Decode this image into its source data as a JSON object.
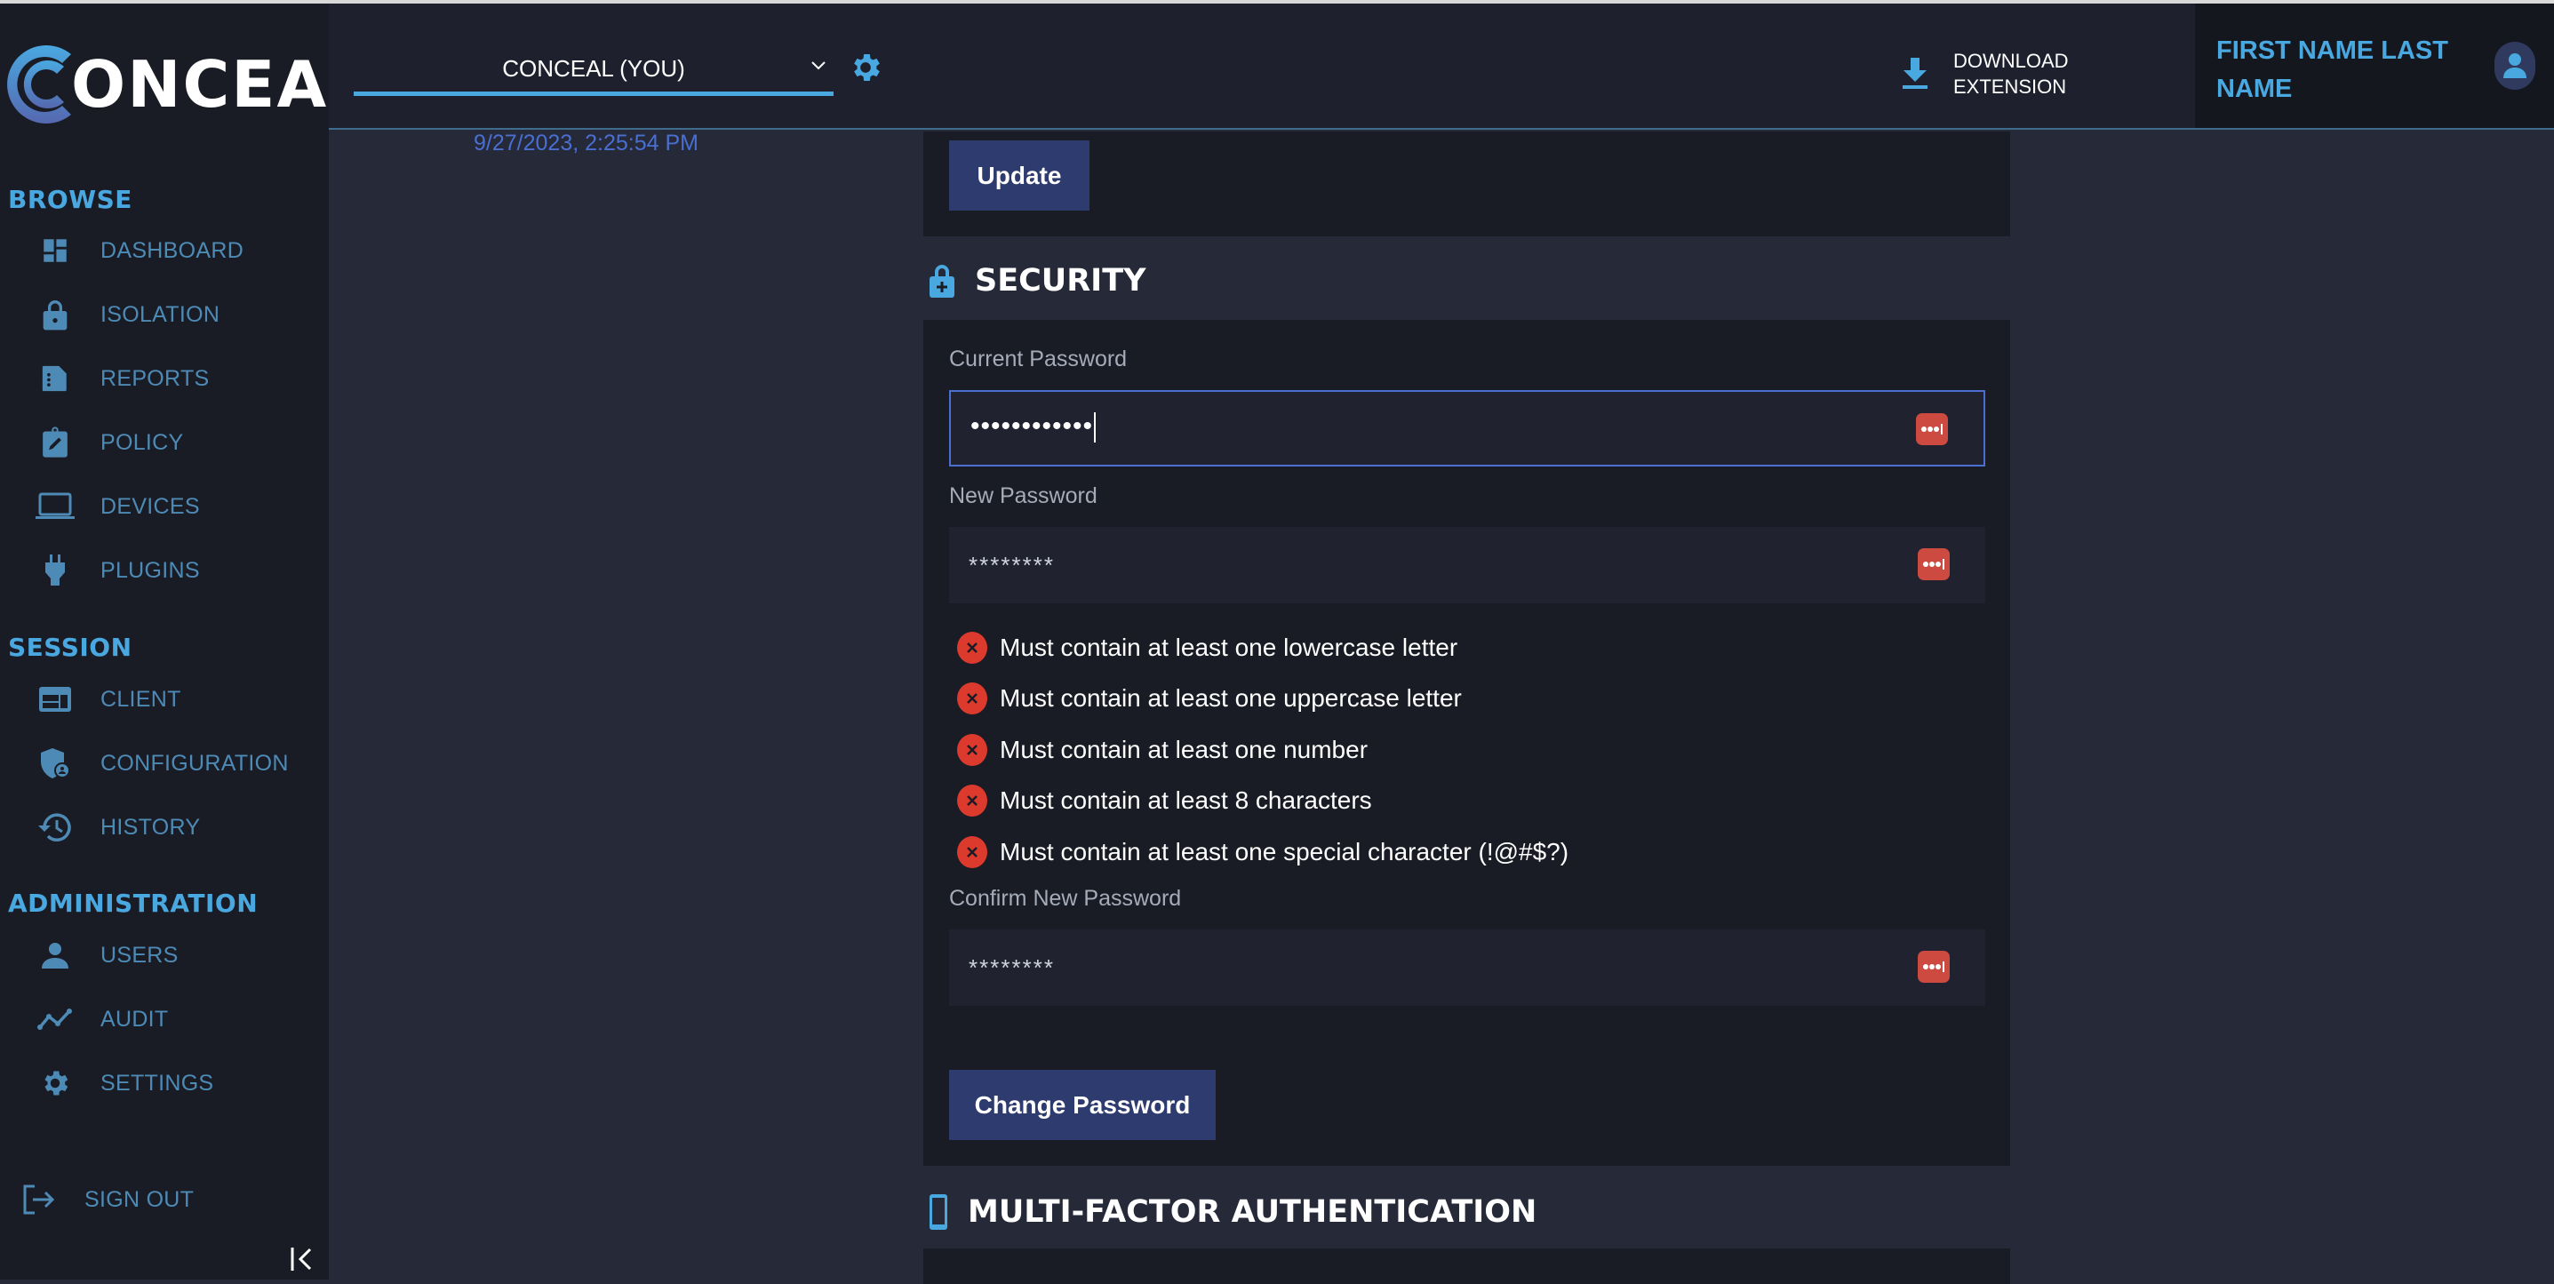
{
  "app": {
    "brand": "ONCEAL",
    "brand_full": "CONCEAL"
  },
  "sidebar": {
    "sections": [
      {
        "title": "BROWSE",
        "items": [
          {
            "label": "DASHBOARD",
            "icon": "dashboard-icon"
          },
          {
            "label": "ISOLATION",
            "icon": "lock-icon"
          },
          {
            "label": "REPORTS",
            "icon": "report-icon"
          },
          {
            "label": "POLICY",
            "icon": "clipboard-edit-icon"
          },
          {
            "label": "DEVICES",
            "icon": "laptop-icon"
          },
          {
            "label": "PLUGINS",
            "icon": "plug-icon"
          }
        ]
      },
      {
        "title": "SESSION",
        "items": [
          {
            "label": "CLIENT",
            "icon": "browser-window-icon"
          },
          {
            "label": "CONFIGURATION",
            "icon": "shield-user-icon"
          },
          {
            "label": "HISTORY",
            "icon": "history-icon"
          }
        ]
      },
      {
        "title": "ADMINISTRATION",
        "items": [
          {
            "label": "USERS",
            "icon": "user-icon"
          },
          {
            "label": "AUDIT",
            "icon": "trend-line-icon"
          },
          {
            "label": "SETTINGS",
            "icon": "gear-icon"
          }
        ]
      }
    ],
    "sign_out": "SIGN OUT"
  },
  "header": {
    "org_select": "CONCEAL (YOU)",
    "download_line1": "DOWNLOAD",
    "download_line2": "EXTENSION",
    "user_name": "FIRST NAME LAST NAME"
  },
  "main": {
    "timestamp": "9/27/2023, 2:25:54 PM",
    "update_button": "Update",
    "security": {
      "title": "SECURITY",
      "current_password_label": "Current Password",
      "current_password_value": "••••••••••••",
      "new_password_label": "New Password",
      "new_password_placeholder": "********",
      "requirements": [
        "Must contain at least one lowercase letter",
        "Must contain at least one uppercase letter",
        "Must contain at least one number",
        "Must contain at least 8 characters",
        "Must contain at least one special character (!@#$?)"
      ],
      "confirm_password_label": "Confirm New Password",
      "confirm_password_placeholder": "********",
      "change_button": "Change Password"
    },
    "mfa": {
      "title": "MULTI-FACTOR AUTHENTICATION"
    }
  },
  "colors": {
    "accent": "#4aa8e0",
    "nav_text": "#4d8ab5",
    "button": "#2e3b6e",
    "error": "#dd3a2e",
    "password_manager": "#cc4a3f",
    "timestamp": "#4a6fd1"
  }
}
